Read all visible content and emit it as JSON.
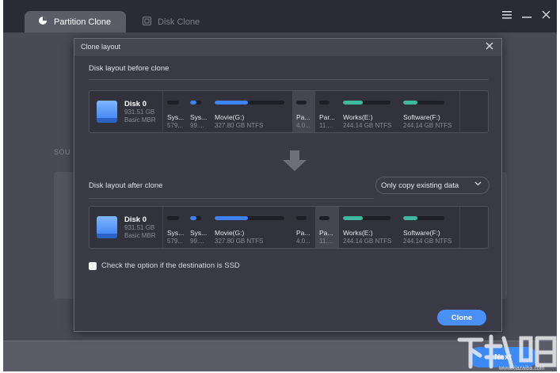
{
  "app": {
    "tabs": [
      {
        "label": "Partition Clone",
        "active": true,
        "icon": "pie-chart-icon"
      },
      {
        "label": "Disk Clone",
        "active": false,
        "icon": "disk-copy-icon"
      }
    ],
    "window_controls": [
      "menu-icon",
      "minimize-icon",
      "close-icon"
    ],
    "background_section_label": "SOU",
    "next_label": "Next",
    "colors": {
      "accent": "#3d8af7",
      "background": "#5c5c69",
      "titlebar": "#2b2b36"
    }
  },
  "modal": {
    "title": "Clone layout",
    "before_label": "Disk layout before clone",
    "after_label": "Disk layout after clone",
    "dropdown": {
      "selected": "Only copy existing data"
    },
    "ssd_checkbox_label": "Check the option if the destination is SSD",
    "clone_label": "Clone"
  },
  "disk_before": {
    "name": "Disk 0",
    "size": "931.51 GB",
    "type": "Basic MBR",
    "partitions": [
      {
        "name": "Sys...",
        "size": "579...",
        "fill": 0,
        "color": "#3d82f0",
        "selected": false
      },
      {
        "name": "Sys...",
        "size": "99....",
        "fill": 0.55,
        "color": "#3d82f0",
        "selected": false
      },
      {
        "name": "Movie(G:)",
        "size": "327.80 GB NTFS",
        "fill": 0.48,
        "color": "#3d82f0",
        "selected": false
      },
      {
        "name": "Pa...",
        "size": "4.0...",
        "fill": 0,
        "color": "#3d82f0",
        "selected": true
      },
      {
        "name": "Par...",
        "size": "11....",
        "fill": 0,
        "color": "#3d82f0",
        "selected": false
      },
      {
        "name": "Works(E:)",
        "size": "244.14 GB NTFS",
        "fill": 0.42,
        "color": "#3fb8a0",
        "selected": false
      },
      {
        "name": "Software(F:)",
        "size": "244.14 GB NTFS",
        "fill": 0.35,
        "color": "#3fb8a0",
        "selected": false
      }
    ]
  },
  "disk_after": {
    "name": "Disk 0",
    "size": "931.51 GB",
    "type": "Basic MBR",
    "partitions": [
      {
        "name": "Sys...",
        "size": "579...",
        "fill": 0,
        "color": "#3d82f0",
        "selected": false
      },
      {
        "name": "Sys...",
        "size": "99....",
        "fill": 0.55,
        "color": "#3d82f0",
        "selected": false
      },
      {
        "name": "Movie(G:)",
        "size": "327.80 GB NTFS",
        "fill": 0.48,
        "color": "#3d82f0",
        "selected": false
      },
      {
        "name": "Pa...",
        "size": "4.0...",
        "fill": 0,
        "color": "#3d82f0",
        "selected": false
      },
      {
        "name": "Pa...",
        "size": "11....",
        "fill": 0,
        "color": "#3d82f0",
        "selected": true
      },
      {
        "name": "Works(E:)",
        "size": "244.14 GB NTFS",
        "fill": 0.42,
        "color": "#3fb8a0",
        "selected": false
      },
      {
        "name": "Software(F:)",
        "size": "244.14 GB NTFS",
        "fill": 0.35,
        "color": "#3fb8a0",
        "selected": false
      }
    ]
  }
}
